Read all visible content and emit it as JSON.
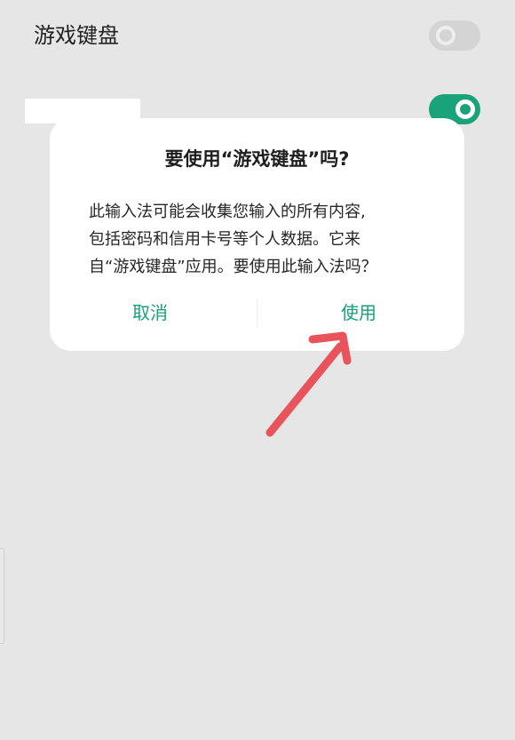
{
  "setting": {
    "title": "游戏键盘"
  },
  "dialog": {
    "title": "要使用“游戏键盘”吗?",
    "body_lines": [
      "此输入法可能会收集您输入的所有内容,",
      "包括密码和信用卡号等个人数据。它来",
      "自“游戏键盘”应用。要使用此输入法吗？"
    ],
    "cancel_label": "取消",
    "confirm_label": "使用"
  },
  "colors": {
    "accent": "#16a07c",
    "toggle_on": "#1aa37a",
    "arrow": "#e9535c"
  },
  "icons": {
    "annotation": "arrow-icon"
  }
}
